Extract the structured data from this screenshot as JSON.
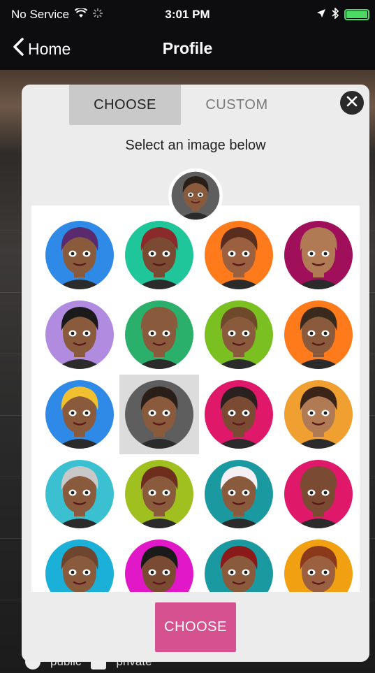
{
  "status_bar": {
    "carrier": "No Service",
    "time": "3:01 PM"
  },
  "nav": {
    "back_label": "Home",
    "title": "Profile"
  },
  "background_hint": {
    "public_label": "public",
    "private_label": "private"
  },
  "picker": {
    "tabs": [
      {
        "label": "CHOOSE",
        "active": true
      },
      {
        "label": "CUSTOM",
        "active": false
      }
    ],
    "instructions": "Select an image below",
    "choose_button_label": "CHOOSE",
    "selected_index": 9,
    "avatars": [
      {
        "name": "avatar-purple-hair-headset",
        "ring": "#2e8ae6",
        "skin": "#8a5a3c",
        "hair": "#5a2a6e"
      },
      {
        "name": "avatar-red-hair-green",
        "ring": "#1fc69a",
        "skin": "#7a4a32",
        "hair": "#8a2a2a"
      },
      {
        "name": "avatar-bob-orange",
        "ring": "#ff7a1a",
        "skin": "#9a6040",
        "hair": "#5a2e1e"
      },
      {
        "name": "avatar-bald-magenta",
        "ring": "#a0105a",
        "skin": "#b07a55",
        "hair": "#b07a55"
      },
      {
        "name": "avatar-hat-singer",
        "ring": "#b08be0",
        "skin": "#8a5a3c",
        "hair": "#1a1a1a"
      },
      {
        "name": "avatar-bald-glasses",
        "ring": "#2ab06a",
        "skin": "#8a5a3c",
        "hair": "#8a5a3c"
      },
      {
        "name": "avatar-flower-crown",
        "ring": "#7ac020",
        "skin": "#8a5a3c",
        "hair": "#6e4a2a"
      },
      {
        "name": "avatar-floral-orange",
        "ring": "#ff7a1a",
        "skin": "#8a5a3c",
        "hair": "#3a2a1e"
      },
      {
        "name": "avatar-blonde-flowers",
        "ring": "#2e8ae6",
        "skin": "#8a5a3c",
        "hair": "#f0c030"
      },
      {
        "name": "avatar-short-hair-gray",
        "ring": "#5e5e5e",
        "skin": "#8a5a3c",
        "hair": "#2a1e18"
      },
      {
        "name": "avatar-beard-magenta",
        "ring": "#e0186a",
        "skin": "#7a4a32",
        "hair": "#2a2020"
      },
      {
        "name": "avatar-smile-orange",
        "ring": "#f0a030",
        "skin": "#b07a55",
        "hair": "#3a2418"
      },
      {
        "name": "avatar-gray-hair-cyan",
        "ring": "#3ac0d0",
        "skin": "#8a5a3c",
        "hair": "#c8c8c8"
      },
      {
        "name": "avatar-curly-lime",
        "ring": "#a0c020",
        "skin": "#8a5a3c",
        "hair": "#6e2e1e"
      },
      {
        "name": "avatar-sunhat-teal",
        "ring": "#1a9aa0",
        "skin": "#8a5a3c",
        "hair": "#f4f0f4"
      },
      {
        "name": "avatar-headphones-pink",
        "ring": "#e0186a",
        "skin": "#7a4a32",
        "hair": "#7a4a32"
      },
      {
        "name": "avatar-cyan-boy",
        "ring": "#1ab0d8",
        "skin": "#8a5a3c",
        "hair": "#6e4630"
      },
      {
        "name": "avatar-grin-magenta",
        "ring": "#e018c8",
        "skin": "#7a4a32",
        "hair": "#1a1a1a"
      },
      {
        "name": "avatar-tophat-teal",
        "ring": "#1a9aa0",
        "skin": "#8a5a3c",
        "hair": "#8a1a1a"
      },
      {
        "name": "avatar-crown-orange",
        "ring": "#f0a010",
        "skin": "#9a6040",
        "hair": "#8a3a1a"
      }
    ]
  },
  "colors": {
    "accent": "#d6518f",
    "sheet_bg": "#ececec",
    "tab_active_bg": "#c9c9c9",
    "battery": "#4cd964"
  }
}
